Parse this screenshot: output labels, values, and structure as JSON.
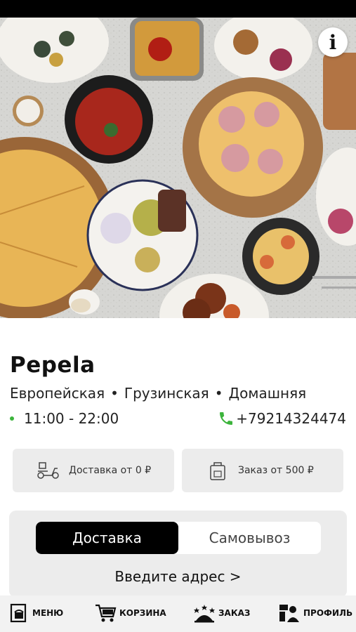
{
  "restaurant": {
    "name": "Pepela",
    "cuisines": [
      "Европейская",
      "Грузинская",
      "Домашняя"
    ],
    "cuisine_separator": "•",
    "hours": "11:00 - 22:00",
    "phone": "+79214324474"
  },
  "info_button": {
    "label": "i"
  },
  "cards": {
    "delivery": "Доставка от 0 ₽",
    "min_order": "Заказ от 500 ₽"
  },
  "order_mode": {
    "options": [
      "Доставка",
      "Самовывоз"
    ],
    "selected": "Доставка",
    "address_prompt": "Введите адрес >"
  },
  "tabbar": {
    "items": [
      {
        "label": "МЕНЮ",
        "icon": "menu-icon"
      },
      {
        "label": "КОРЗИНА",
        "icon": "cart-icon"
      },
      {
        "label": "ЗАКАЗ",
        "icon": "cloche-icon"
      },
      {
        "label": "ПРОФИЛЬ",
        "icon": "profile-icon"
      }
    ]
  },
  "colors": {
    "accent_green": "#3cb43c",
    "active_toggle": "#000000",
    "panel_bg": "#ececec"
  }
}
